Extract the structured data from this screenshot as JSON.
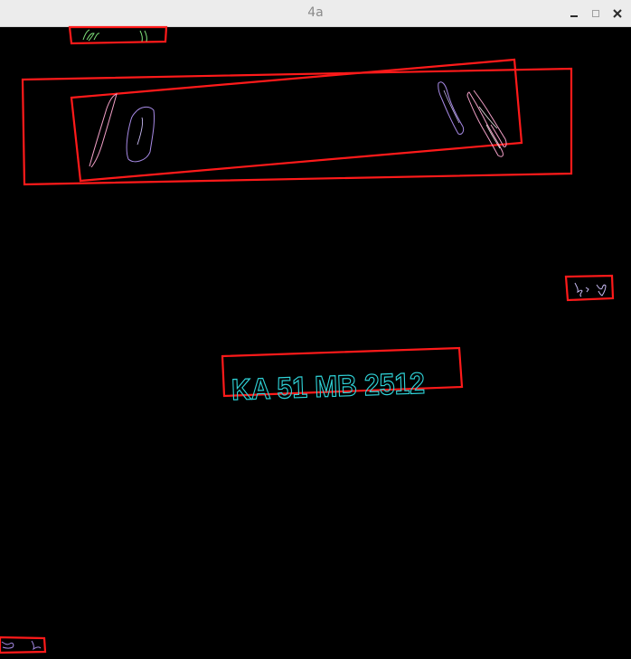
{
  "window": {
    "title": "4a",
    "controls": {
      "minimize_icon": "minimize-icon",
      "maximize_icon": "maximize-icon",
      "close_icon": "close-icon"
    }
  },
  "image": {
    "background_color": "#000000",
    "detection_box_color": "#ff1a1a",
    "plate": {
      "text": "KA 51 MB 2512",
      "color": "#2fd3d8"
    },
    "contour_colors": {
      "green": "#7fe07a",
      "pink": "#f3a0c8",
      "purple": "#a78ae6",
      "lavender": "#c7b9f2",
      "white": "#f0e9e9"
    }
  }
}
